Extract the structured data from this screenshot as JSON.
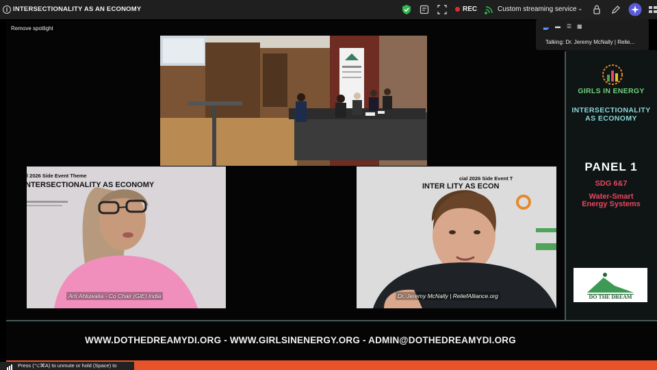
{
  "window": {
    "title": "INTERSECTIONALITY AS AN ECONOMY",
    "rec_label": "REC",
    "streaming_label": "Custom streaming service"
  },
  "stage": {
    "spotlight_label": "Remove spotlight",
    "talking_label": "Talking: Dr. Jeremy McNally | Relie..."
  },
  "participants": [
    {
      "name_tag": "Arti Ahluwalia - Co Chair (GiE) India"
    },
    {
      "name_tag": "Dr. Jeremy McNally | ReliefAlliance.org"
    }
  ],
  "sidebar": {
    "brand": "GIRLS IN ENERGY",
    "theme_line1": "INTERSECTIONALITY",
    "theme_line2": "AS ECONOMY",
    "panel": "PANEL 1",
    "sdg": "SDG 6&7",
    "topic_line1": "Water-Smart",
    "topic_line2": "Energy Systems",
    "logo_text": "DO THE DREAM"
  },
  "slide_fragments": {
    "left_heading_small": "l 2026 Side Event Theme",
    "left_heading_large": "NTERSECTIONALITY AS ECONOMY",
    "right_heading_small": "cial 2026 Side Event T",
    "right_heading_large": "INTER    LITY AS ECON"
  },
  "footer": {
    "links": "WWW.DOTHEDREAMYDI.ORG - WWW.GIRLSINENERGY.ORG - ADMIN@DOTHEDREAMYDI.ORG"
  },
  "toast": {
    "text": "Press (⌥⌘A) to unmute or hold (Space) to"
  },
  "colors": {
    "accent_green": "#6fd07a",
    "accent_teal": "#8ad9d9",
    "accent_red": "#e8475f",
    "footer_bar": "#e8542a",
    "rec_red": "#e02b2b"
  }
}
